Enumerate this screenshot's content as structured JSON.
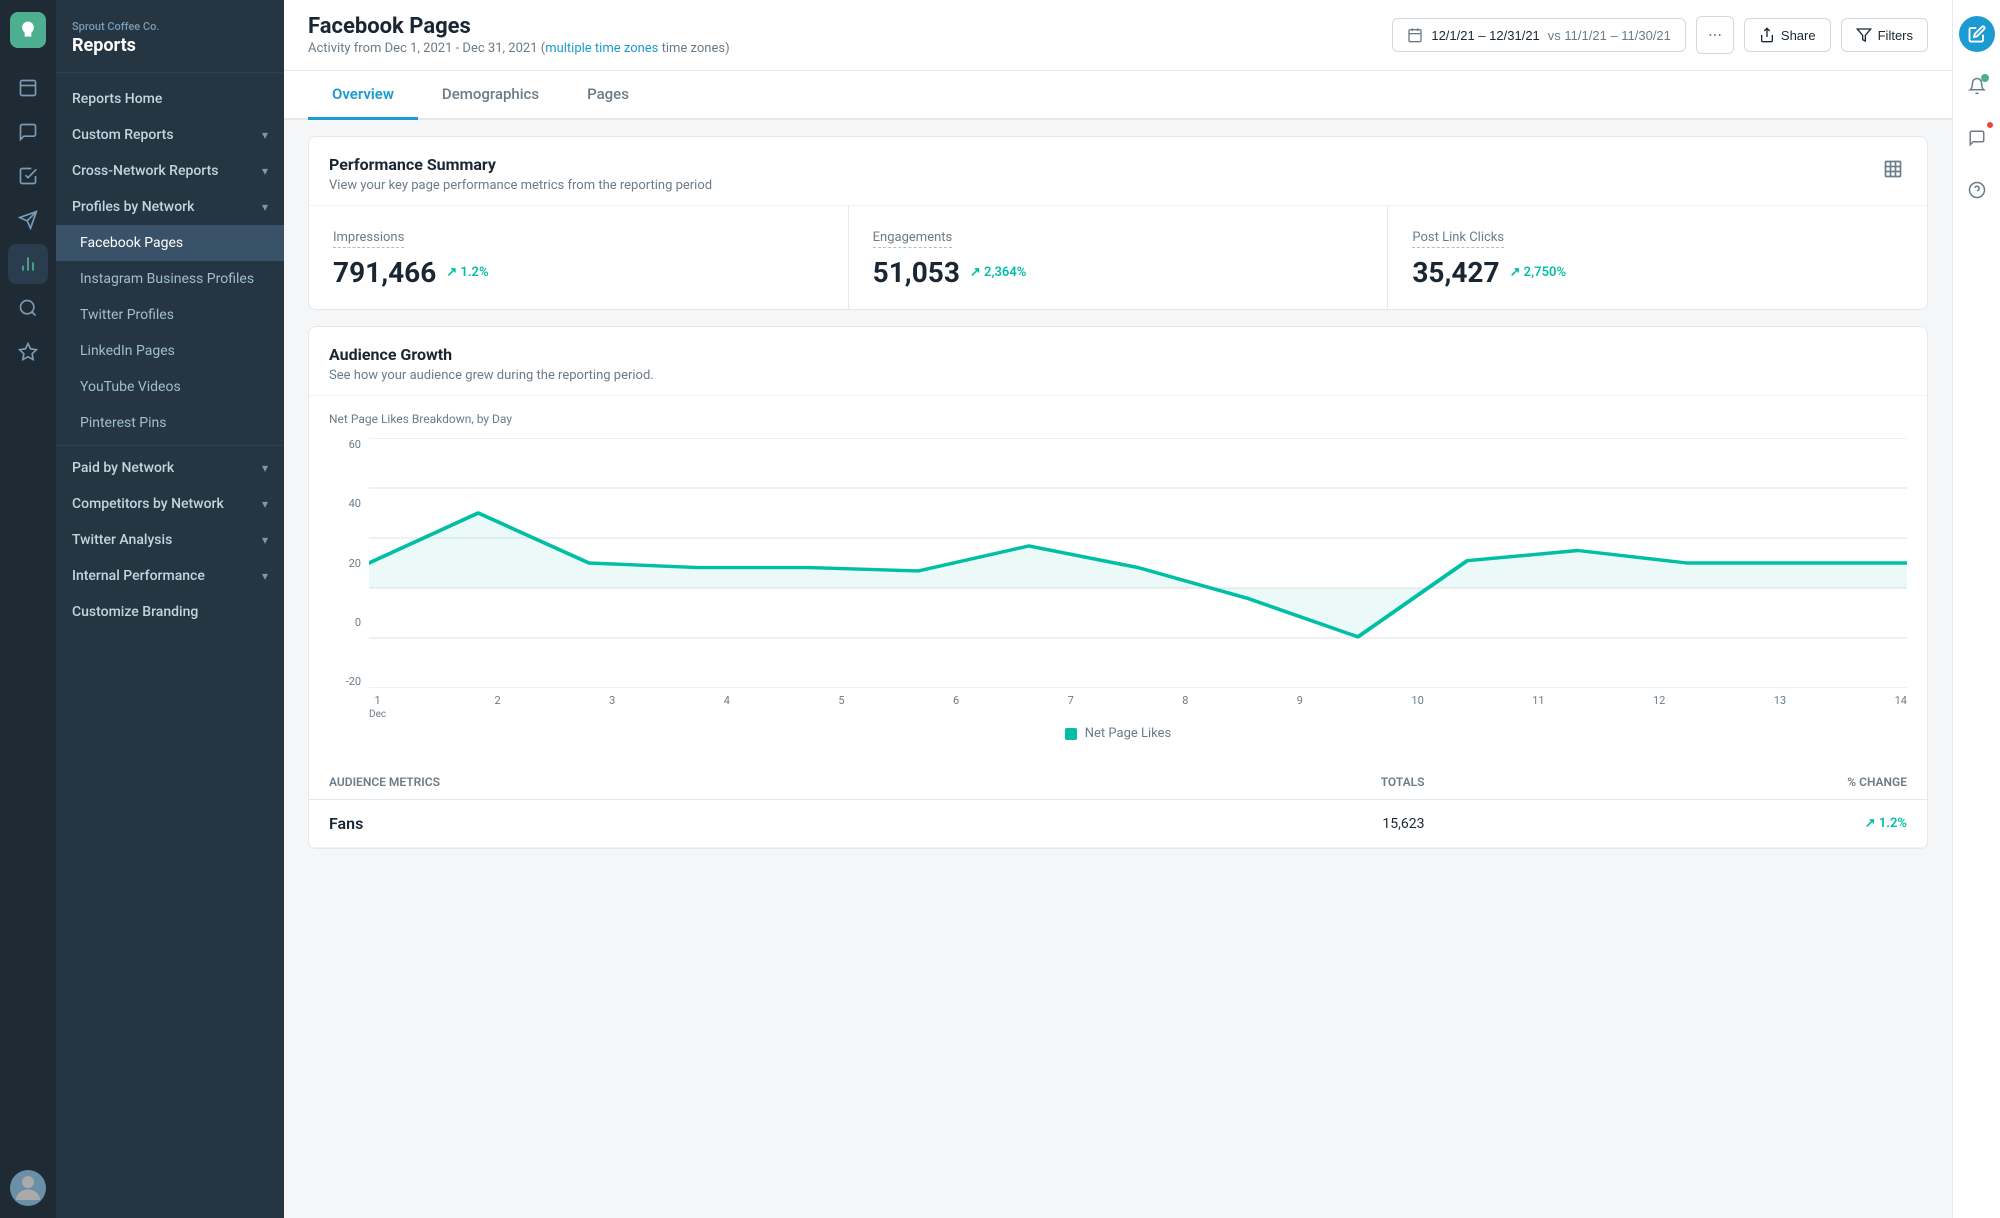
{
  "app": {
    "brand": "Sprout Coffee Co.",
    "section": "Reports"
  },
  "sidebar": {
    "items": [
      {
        "id": "reports-home",
        "label": "Reports Home",
        "indent": false,
        "hasChevron": false
      },
      {
        "id": "custom-reports",
        "label": "Custom Reports",
        "indent": false,
        "hasChevron": true
      },
      {
        "id": "cross-network",
        "label": "Cross-Network Reports",
        "indent": false,
        "hasChevron": true
      },
      {
        "id": "profiles-by-network",
        "label": "Profiles by Network",
        "indent": false,
        "hasChevron": true
      },
      {
        "id": "facebook-pages",
        "label": "Facebook Pages",
        "indent": true,
        "hasChevron": false,
        "active": true
      },
      {
        "id": "instagram-business",
        "label": "Instagram Business Profiles",
        "indent": true,
        "hasChevron": false
      },
      {
        "id": "twitter-profiles",
        "label": "Twitter Profiles",
        "indent": true,
        "hasChevron": false
      },
      {
        "id": "linkedin-pages",
        "label": "LinkedIn Pages",
        "indent": true,
        "hasChevron": false
      },
      {
        "id": "youtube-videos",
        "label": "YouTube Videos",
        "indent": true,
        "hasChevron": false
      },
      {
        "id": "pinterest-pins",
        "label": "Pinterest Pins",
        "indent": true,
        "hasChevron": false
      },
      {
        "id": "paid-by-network",
        "label": "Paid by Network",
        "indent": false,
        "hasChevron": true
      },
      {
        "id": "competitors-by-network",
        "label": "Competitors by Network",
        "indent": false,
        "hasChevron": true
      },
      {
        "id": "twitter-analysis",
        "label": "Twitter Analysis",
        "indent": false,
        "hasChevron": true
      },
      {
        "id": "internal-performance",
        "label": "Internal Performance",
        "indent": false,
        "hasChevron": true
      },
      {
        "id": "customize-branding",
        "label": "Customize Branding",
        "indent": false,
        "hasChevron": false
      }
    ]
  },
  "header": {
    "title": "Facebook Pages",
    "subtitle": "Activity from Dec 1, 2021 - Dec 31, 2021",
    "subtitle_link": "multiple time zones",
    "date_range": "12/1/21 – 12/31/21",
    "vs_date_range": "vs 11/1/21 – 11/30/21",
    "share_label": "Share",
    "filters_label": "Filters"
  },
  "tabs": [
    {
      "id": "overview",
      "label": "Overview",
      "active": true
    },
    {
      "id": "demographics",
      "label": "Demographics",
      "active": false
    },
    {
      "id": "pages",
      "label": "Pages",
      "active": false
    }
  ],
  "performance_summary": {
    "title": "Performance Summary",
    "subtitle": "View your key page performance metrics from the reporting period",
    "metrics": [
      {
        "id": "impressions",
        "label": "Impressions",
        "value": "791,466",
        "change": "↗ 1.2%",
        "change_raw": "1.2%"
      },
      {
        "id": "engagements",
        "label": "Engagements",
        "value": "51,053",
        "change": "↗ 2,364%",
        "change_raw": "2,364%"
      },
      {
        "id": "post-link-clicks",
        "label": "Post Link Clicks",
        "value": "35,427",
        "change": "↗ 2,750%",
        "change_raw": "2,750%"
      }
    ]
  },
  "audience_growth": {
    "title": "Audience Growth",
    "subtitle": "See how your audience grew during the reporting period.",
    "chart_label": "Net Page Likes Breakdown, by Day",
    "y_axis": [
      "60",
      "40",
      "20",
      "0",
      "-20"
    ],
    "x_axis": [
      {
        "value": "1",
        "sub": "Dec"
      },
      {
        "value": "2",
        "sub": ""
      },
      {
        "value": "3",
        "sub": ""
      },
      {
        "value": "4",
        "sub": ""
      },
      {
        "value": "5",
        "sub": ""
      },
      {
        "value": "6",
        "sub": ""
      },
      {
        "value": "7",
        "sub": ""
      },
      {
        "value": "8",
        "sub": ""
      },
      {
        "value": "9",
        "sub": ""
      },
      {
        "value": "10",
        "sub": ""
      },
      {
        "value": "11",
        "sub": ""
      },
      {
        "value": "12",
        "sub": ""
      },
      {
        "value": "13",
        "sub": ""
      },
      {
        "value": "14",
        "sub": ""
      }
    ],
    "legend_label": "Net Page Likes"
  },
  "audience_metrics": {
    "columns": [
      "Audience Metrics",
      "Totals",
      "% Change"
    ],
    "rows": [
      {
        "label": "Fans",
        "total": "15,623",
        "change": "↗ 1.2%"
      }
    ]
  }
}
